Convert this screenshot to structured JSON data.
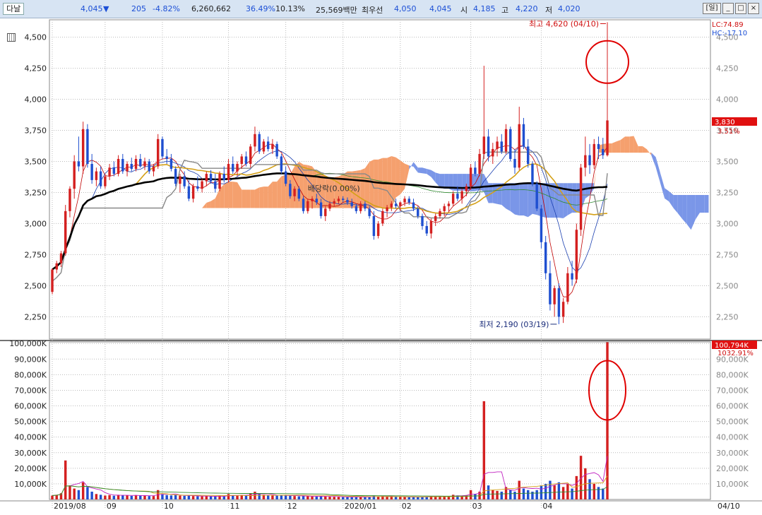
{
  "header": {
    "stock_name": "다날",
    "price": "4,045",
    "change_arrow": "▼",
    "change": "205",
    "change_pct": "-4.82%",
    "volume": "6,260,662",
    "vol_ratio": "36.49%",
    "turnover": "10.13%",
    "amount": "25,569백만",
    "best_label": "최우선",
    "ask": "4,050",
    "bid": "4,045",
    "open_label": "시",
    "open": "4,185",
    "high_label": "고",
    "high": "4,220",
    "low_label": "저",
    "low": "4,020",
    "period_btn": "[일]"
  },
  "colors": {
    "up": "#d42020",
    "down": "#1f4fd0",
    "cloud_up": "#f5a06e",
    "cloud_down": "#7a96e8",
    "ma_long": "#000000",
    "ma_gold": "#d4a017"
  },
  "chart_data": {
    "type": "candlestick",
    "price_axis": {
      "ticks": [
        4500,
        4250,
        4000,
        3750,
        3500,
        3250,
        3000,
        2750,
        2500,
        2250
      ],
      "tick_labels": [
        "4,500",
        "4,250",
        "4,000",
        "3,750",
        "3,500",
        "3,250",
        "3,000",
        "2,750",
        "2,500",
        "2,250"
      ],
      "range": [
        2070,
        4640
      ]
    },
    "volume_axis": {
      "ticks": [
        100000,
        90000,
        80000,
        70000,
        60000,
        50000,
        40000,
        30000,
        20000,
        10000
      ],
      "tick_labels": [
        "100,000K",
        "90,000K",
        "80,000K",
        "70,000K",
        "60,000K",
        "50,000K",
        "40,000K",
        "30,000K",
        "20,000K",
        "10,000K"
      ],
      "range": [
        0,
        101000
      ],
      "unit": "K"
    },
    "x_labels": [
      "2019/08",
      "09",
      "10",
      "11",
      "12",
      "2020/01",
      "02",
      "03",
      "04"
    ],
    "x_label_right": "04/10",
    "right_labels": {
      "lc": "LC:74.89",
      "hc": "HC:-17.10",
      "last_price": "3,830",
      "last_pct": "3.51%",
      "last_vol": "100,794K",
      "last_vol_pct": "1032.91%"
    },
    "annotations": {
      "high": "최고 4,620 (04/10)",
      "low": "최저 2,190 (03/19)",
      "dividend": "배당락(0.00%)"
    },
    "high_value": 4620,
    "low_value": 2190,
    "candles": [
      [
        2450,
        2640,
        2430,
        2630,
        2500
      ],
      [
        2630,
        2700,
        2600,
        2680,
        3000
      ],
      [
        2680,
        2780,
        2650,
        2760,
        4000
      ],
      [
        2760,
        3150,
        2740,
        3100,
        25000
      ],
      [
        3100,
        3300,
        3050,
        3280,
        9000
      ],
      [
        3280,
        3550,
        3200,
        3500,
        7000
      ],
      [
        3500,
        3700,
        3420,
        3460,
        6000
      ],
      [
        3460,
        3820,
        3400,
        3760,
        11000
      ],
      [
        3760,
        3800,
        3450,
        3480,
        8000
      ],
      [
        3480,
        3560,
        3320,
        3350,
        5000
      ],
      [
        3350,
        3450,
        3300,
        3420,
        3500
      ],
      [
        3420,
        3460,
        3280,
        3300,
        3000
      ],
      [
        3300,
        3400,
        3280,
        3380,
        2500
      ],
      [
        3380,
        3480,
        3350,
        3450,
        2800
      ],
      [
        3450,
        3500,
        3380,
        3400,
        2400
      ],
      [
        3400,
        3550,
        3380,
        3520,
        3000
      ],
      [
        3520,
        3560,
        3400,
        3420,
        2600
      ],
      [
        3420,
        3500,
        3380,
        3480,
        2500
      ],
      [
        3480,
        3530,
        3420,
        3440,
        2300
      ],
      [
        3440,
        3550,
        3420,
        3520,
        2800
      ],
      [
        3520,
        3560,
        3450,
        3460,
        2500
      ],
      [
        3460,
        3530,
        3430,
        3500,
        2300
      ],
      [
        3500,
        3520,
        3400,
        3420,
        2200
      ],
      [
        3420,
        3480,
        3380,
        3460,
        2200
      ],
      [
        3460,
        3720,
        3440,
        3680,
        6000
      ],
      [
        3680,
        3700,
        3520,
        3540,
        3500
      ],
      [
        3540,
        3600,
        3480,
        3520,
        2800
      ],
      [
        3520,
        3560,
        3420,
        3440,
        2600
      ],
      [
        3440,
        3460,
        3300,
        3320,
        2800
      ],
      [
        3320,
        3400,
        3250,
        3380,
        2500
      ],
      [
        3380,
        3420,
        3280,
        3300,
        2300
      ],
      [
        3300,
        3350,
        3180,
        3200,
        2400
      ],
      [
        3200,
        3320,
        3170,
        3300,
        2200
      ],
      [
        3300,
        3380,
        3260,
        3280,
        2000
      ],
      [
        3280,
        3360,
        3250,
        3340,
        2000
      ],
      [
        3340,
        3420,
        3300,
        3400,
        2200
      ],
      [
        3400,
        3430,
        3320,
        3340,
        2000
      ],
      [
        3340,
        3400,
        3250,
        3280,
        1900
      ],
      [
        3280,
        3420,
        3260,
        3400,
        2400
      ],
      [
        3400,
        3460,
        3330,
        3350,
        2000
      ],
      [
        3350,
        3520,
        3330,
        3480,
        3500
      ],
      [
        3480,
        3540,
        3400,
        3420,
        2600
      ],
      [
        3420,
        3500,
        3380,
        3480,
        2400
      ],
      [
        3480,
        3560,
        3440,
        3540,
        2800
      ],
      [
        3540,
        3580,
        3460,
        3480,
        2400
      ],
      [
        3480,
        3640,
        3450,
        3620,
        4000
      ],
      [
        3620,
        3780,
        3580,
        3720,
        5000
      ],
      [
        3720,
        3740,
        3560,
        3580,
        3500
      ],
      [
        3580,
        3680,
        3560,
        3660,
        3000
      ],
      [
        3660,
        3700,
        3580,
        3600,
        2600
      ],
      [
        3600,
        3680,
        3560,
        3640,
        2500
      ],
      [
        3640,
        3660,
        3520,
        3540,
        2400
      ],
      [
        3540,
        3560,
        3400,
        3420,
        2800
      ],
      [
        3420,
        3460,
        3300,
        3320,
        2600
      ],
      [
        3320,
        3350,
        3200,
        3220,
        2400
      ],
      [
        3220,
        3300,
        3180,
        3280,
        2200
      ],
      [
        3280,
        3300,
        3180,
        3200,
        2000
      ],
      [
        3200,
        3220,
        3080,
        3100,
        2200
      ],
      [
        3100,
        3200,
        3080,
        3180,
        2100
      ],
      [
        3180,
        3220,
        3120,
        3200,
        1900
      ],
      [
        3200,
        3240,
        3150,
        3170,
        1800
      ],
      [
        3170,
        3200,
        3040,
        3060,
        2100
      ],
      [
        3060,
        3140,
        3020,
        3120,
        2000
      ],
      [
        3120,
        3180,
        3100,
        3160,
        1800
      ],
      [
        3160,
        3200,
        3140,
        3180,
        1700
      ],
      [
        3180,
        3220,
        3160,
        3200,
        1600
      ],
      [
        3200,
        3220,
        3170,
        3190,
        1500
      ],
      [
        3190,
        3210,
        3150,
        3170,
        1500
      ],
      [
        3170,
        3200,
        3120,
        3140,
        1500
      ],
      [
        3140,
        3160,
        3080,
        3100,
        1600
      ],
      [
        3100,
        3180,
        3080,
        3160,
        1700
      ],
      [
        3160,
        3180,
        3100,
        3120,
        1500
      ],
      [
        3120,
        3140,
        3040,
        3060,
        1600
      ],
      [
        3060,
        3100,
        2870,
        2900,
        2400
      ],
      [
        2900,
        3020,
        2880,
        3000,
        2000
      ],
      [
        3000,
        3120,
        2980,
        3100,
        2200
      ],
      [
        3100,
        3150,
        3050,
        3130,
        1800
      ],
      [
        3130,
        3180,
        3100,
        3160,
        1700
      ],
      [
        3160,
        3200,
        3120,
        3140,
        1600
      ],
      [
        3140,
        3180,
        3100,
        3170,
        1600
      ],
      [
        3170,
        3220,
        3140,
        3200,
        1700
      ],
      [
        3200,
        3220,
        3150,
        3170,
        1500
      ],
      [
        3170,
        3200,
        3100,
        3120,
        1500
      ],
      [
        3120,
        3140,
        3040,
        3060,
        1600
      ],
      [
        3060,
        3080,
        2950,
        2980,
        1800
      ],
      [
        2980,
        3020,
        2900,
        2920,
        1700
      ],
      [
        2920,
        3040,
        2880,
        3020,
        2000
      ],
      [
        3020,
        3080,
        2980,
        3060,
        1800
      ],
      [
        3060,
        3120,
        3040,
        3100,
        1900
      ],
      [
        3100,
        3160,
        3060,
        3140,
        2000
      ],
      [
        3140,
        3180,
        3100,
        3160,
        2000
      ],
      [
        3160,
        3260,
        3140,
        3240,
        3000
      ],
      [
        3240,
        3300,
        3180,
        3200,
        2600
      ],
      [
        3200,
        3280,
        3160,
        3260,
        2400
      ],
      [
        3260,
        3320,
        3220,
        3300,
        2800
      ],
      [
        3300,
        3480,
        3270,
        3450,
        6000
      ],
      [
        3450,
        3500,
        3380,
        3400,
        3500
      ],
      [
        3400,
        3600,
        3380,
        3560,
        5000
      ],
      [
        3560,
        4270,
        3520,
        3700,
        63000
      ],
      [
        3700,
        3760,
        3500,
        3540,
        9000
      ],
      [
        3540,
        3650,
        3480,
        3600,
        6000
      ],
      [
        3600,
        3700,
        3540,
        3660,
        5500
      ],
      [
        3660,
        3720,
        3560,
        3580,
        5000
      ],
      [
        3580,
        3800,
        3560,
        3760,
        8000
      ],
      [
        3760,
        3780,
        3500,
        3520,
        6000
      ],
      [
        3520,
        3600,
        3400,
        3450,
        5000
      ],
      [
        3450,
        3940,
        3430,
        3800,
        12000
      ],
      [
        3800,
        3850,
        3600,
        3620,
        7000
      ],
      [
        3620,
        3680,
        3450,
        3480,
        6000
      ],
      [
        3480,
        3500,
        3300,
        3320,
        5000
      ],
      [
        3320,
        3340,
        3100,
        3120,
        6000
      ],
      [
        3120,
        3150,
        2800,
        2850,
        9000
      ],
      [
        2850,
        2900,
        2550,
        2600,
        10000
      ],
      [
        2600,
        2700,
        2300,
        2350,
        12000
      ],
      [
        2350,
        2500,
        2250,
        2480,
        9000
      ],
      [
        2480,
        2520,
        2190,
        2250,
        11000
      ],
      [
        2250,
        2400,
        2200,
        2370,
        8000
      ],
      [
        2370,
        2650,
        2350,
        2600,
        10000
      ],
      [
        2600,
        2700,
        2500,
        2550,
        7000
      ],
      [
        2550,
        3000,
        2520,
        2950,
        15000
      ],
      [
        2950,
        3480,
        2900,
        3450,
        28000
      ],
      [
        3450,
        3700,
        3380,
        3550,
        20000
      ],
      [
        3550,
        3640,
        3400,
        3470,
        13000
      ],
      [
        3470,
        3680,
        3440,
        3640,
        10000
      ],
      [
        3640,
        3700,
        3520,
        3600,
        8000
      ],
      [
        3600,
        3690,
        3520,
        3550,
        7000
      ],
      [
        3550,
        4620,
        3540,
        3830,
        100794
      ]
    ]
  }
}
